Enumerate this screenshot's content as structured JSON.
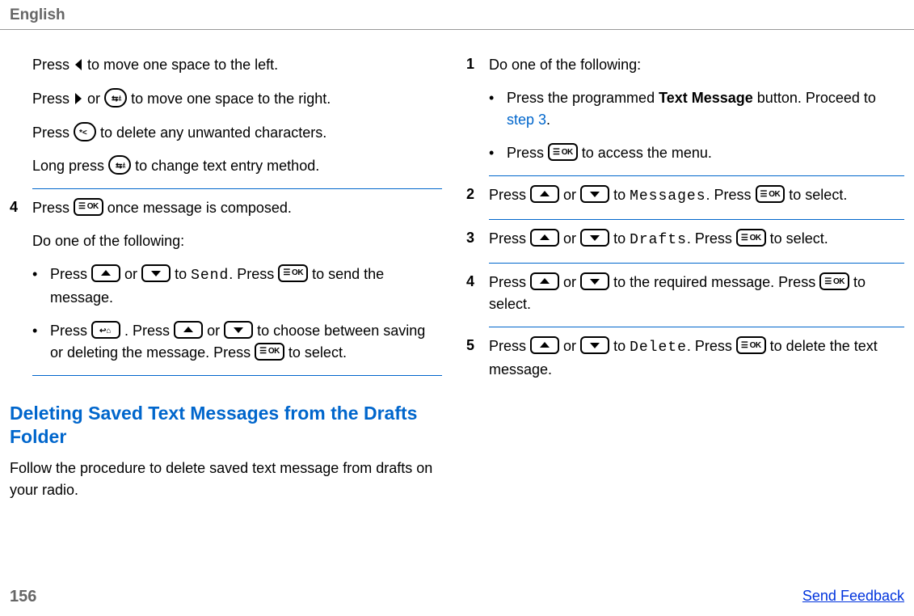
{
  "header": {
    "language": "English"
  },
  "left": {
    "intro": {
      "p1a": "Press ",
      "p1b": " to move one space to the left.",
      "p2a": "Press ",
      "p2b": " or ",
      "p2c": " to move one space to the right.",
      "p3a": "Press ",
      "p3b": " to delete any unwanted characters.",
      "p4a": "Long press ",
      "p4b": " to change text entry method."
    },
    "step4": {
      "num": "4",
      "l1a": "Press ",
      "l1b": " once message is composed.",
      "l2": "Do one of the following:",
      "b1a": "Press ",
      "b1b": " or ",
      "b1c": " to ",
      "b1d": "Send",
      "b1e": ". Press ",
      "b1f": " to send the message.",
      "b2a": "Press ",
      "b2b": " . Press ",
      "b2c": " or ",
      "b2d": " to choose between saving or deleting the message. Press ",
      "b2e": " to select."
    },
    "section": {
      "heading": "Deleting Saved Text Messages from the Drafts Folder",
      "desc": "Follow the procedure to delete saved text message from drafts on your radio."
    }
  },
  "right": {
    "s1": {
      "num": "1",
      "intro": "Do one of the following:",
      "b1a": "Press the programmed ",
      "b1b": "Text Message",
      "b1c": " button. Proceed to ",
      "b1d": "step 3",
      "b1e": ".",
      "b2a": "Press ",
      "b2b": " to access the menu."
    },
    "s2": {
      "num": "2",
      "a": "Press ",
      "b": " or ",
      "c": " to ",
      "d": "Messages",
      "e": ". Press ",
      "f": " to select."
    },
    "s3": {
      "num": "3",
      "a": "Press ",
      "b": " or ",
      "c": " to ",
      "d": "Drafts",
      "e": ". Press ",
      "f": " to select."
    },
    "s4": {
      "num": "4",
      "a": "Press ",
      "b": " or ",
      "c": " to the required message. Press ",
      "d": " to select."
    },
    "s5": {
      "num": "5",
      "a": "Press ",
      "b": " or ",
      "c": " to ",
      "d": "Delete",
      "e": ". Press ",
      "f": " to delete the text message."
    }
  },
  "footer": {
    "page": "156",
    "feedback": "Send Feedback"
  }
}
